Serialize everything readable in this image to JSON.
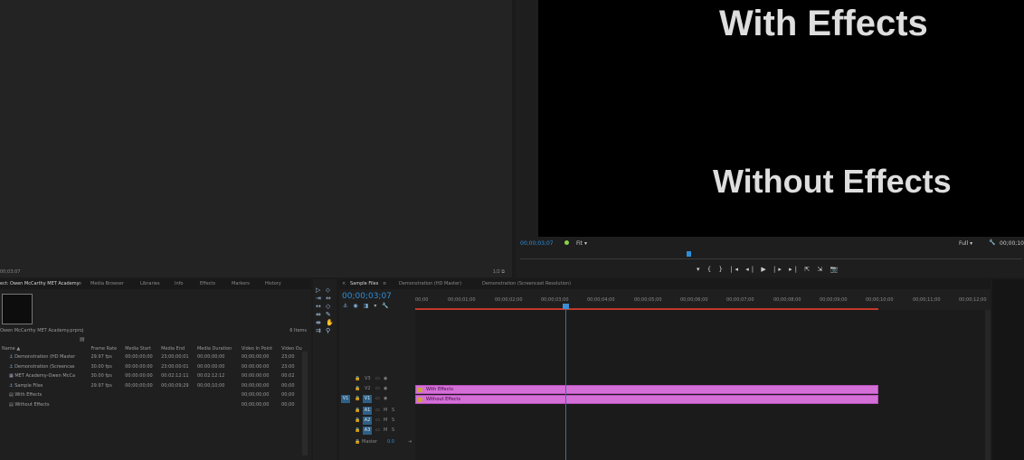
{
  "source_monitor": {
    "timecode": "00;03;07",
    "zoom_label": "1/2"
  },
  "program_monitor": {
    "text_top": "With Effects",
    "text_bottom": "Without Effects",
    "timecode": "00;00;03;07",
    "fit": "Fit",
    "quality": "Full",
    "end_timecode": "00;00;10",
    "transport": [
      "▾",
      "{",
      "}",
      "|◂",
      "◂|",
      "▶",
      "|▸",
      "▸|",
      "⇱",
      "⇲",
      "📷"
    ]
  },
  "project_panel": {
    "tabs": [
      "ect: Owen McCarthy MET Academy",
      "Media Browser",
      "Libraries",
      "Info",
      "Effects",
      "Markers",
      "History"
    ],
    "path": "Owen McCarthy MET Academy.prproj",
    "items_count": "6 Items",
    "columns": [
      "Name ▲",
      "Frame Rate",
      "Media Start",
      "Media End",
      "Media Duration",
      "Video In Point",
      "Video Ou"
    ],
    "rows": [
      {
        "name": "Demonstration (HD Master",
        "fps": "29.97 fps",
        "start": "00;00;00;00",
        "end": "23;00;00;01",
        "dur": "00;00;00;00",
        "vin": "00;00;00;00",
        "vout": "23;00"
      },
      {
        "name": "Demonstration (Screencas",
        "fps": "30.00 fps",
        "start": "00:00:00:00",
        "end": "23:00:00:01",
        "dur": "00:00:00:00",
        "vin": "00:00:00:00",
        "vout": "23:00"
      },
      {
        "name": "MET Academy-Owen McCa",
        "fps": "30.00 fps",
        "start": "00:00:00:00",
        "end": "00:02:12:11",
        "dur": "00:02:12:12",
        "vin": "00:00:00:00",
        "vout": "00:02"
      },
      {
        "name": "Sample Files",
        "fps": "29.97 fps",
        "start": "00;00;00;00",
        "end": "00;00;09;29",
        "dur": "00;00;10;00",
        "vin": "00;00;00;00",
        "vout": "00;00"
      },
      {
        "name": "With Effects",
        "fps": "",
        "start": "",
        "end": "",
        "dur": "",
        "vin": "00;00;00;00",
        "vout": "00;00"
      },
      {
        "name": "Without Effects",
        "fps": "",
        "start": "",
        "end": "",
        "dur": "",
        "vin": "00;00;00;00",
        "vout": "00;00"
      }
    ]
  },
  "timeline": {
    "tabs": [
      "Sample Files",
      "Demonstration (HD Master)",
      "Demonstration (Screencast Resolution)"
    ],
    "timecode": "00;00;03;07",
    "ruler": [
      "00;00",
      "00;00;01;00",
      "00;00;02;00",
      "00;00;03;00",
      "00;00;04;00",
      "00;00;05;00",
      "00;00;06;00",
      "00;00;07;00",
      "00;00;08;00",
      "00;00;09;00",
      "00;00;10;00",
      "00;00;11;00",
      "00;00;12;00"
    ],
    "tracks": {
      "v3": "V3",
      "v2": "V2",
      "v1": "V1",
      "v1_src": "V1",
      "a1": "A1",
      "a2": "A2",
      "a3": "A3",
      "m": "M",
      "s": "S",
      "master": "Master",
      "master_val": "0.0"
    },
    "clips": {
      "with": "With Effects",
      "without": "Without Effects"
    }
  }
}
